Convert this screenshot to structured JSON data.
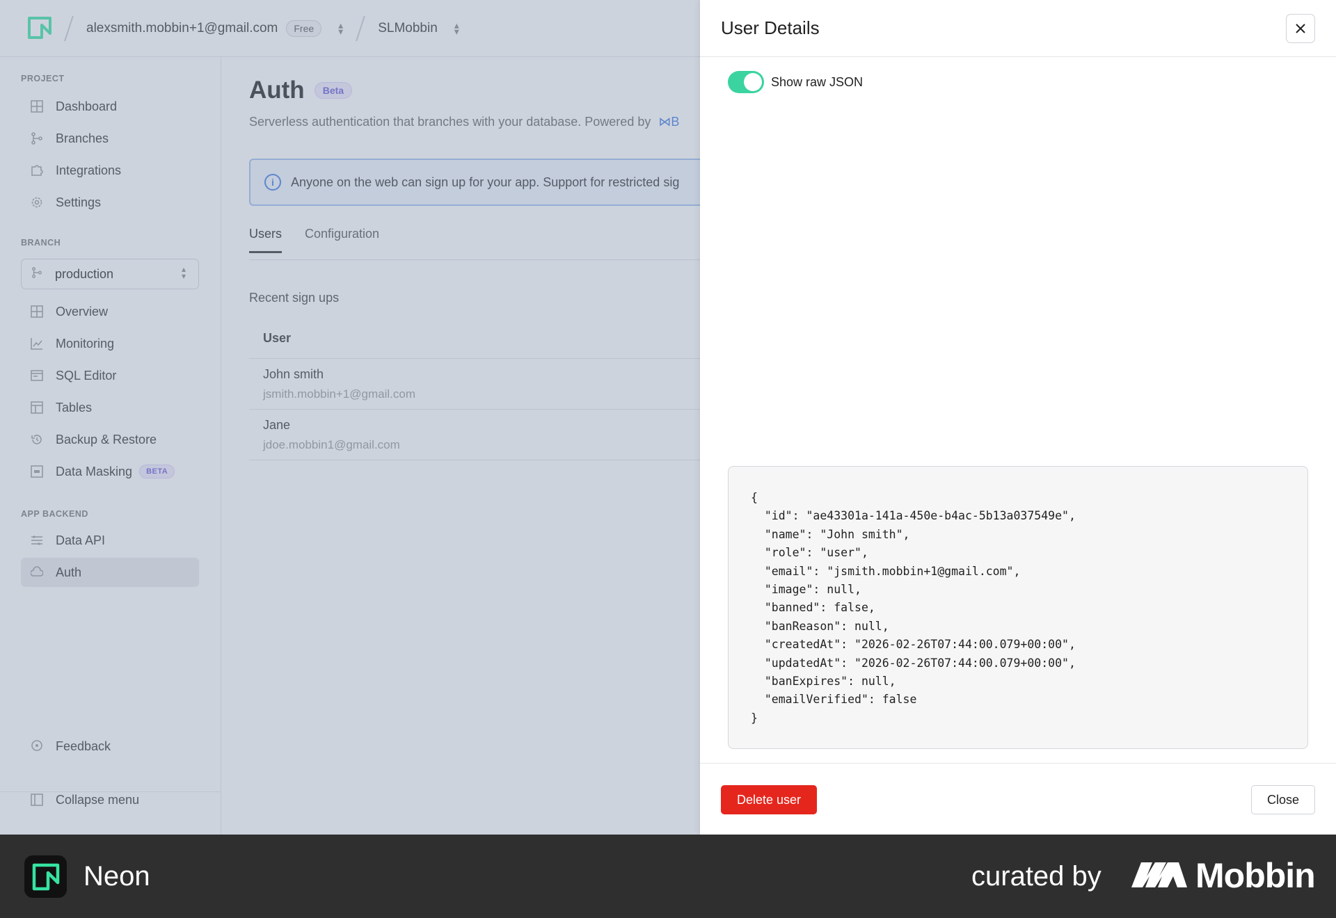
{
  "topbar": {
    "account_email": "alexsmith.mobbin+1@gmail.com",
    "plan_badge": "Free",
    "project_name": "SLMobbin"
  },
  "sidebar": {
    "project_label": "PROJECT",
    "project_items": [
      {
        "label": "Dashboard",
        "icon": "grid-icon"
      },
      {
        "label": "Branches",
        "icon": "branch-icon"
      },
      {
        "label": "Integrations",
        "icon": "puzzle-icon"
      },
      {
        "label": "Settings",
        "icon": "gear-icon"
      }
    ],
    "branch_label": "BRANCH",
    "branch_selected": "production",
    "branch_items": [
      {
        "label": "Overview",
        "icon": "grid-icon"
      },
      {
        "label": "Monitoring",
        "icon": "chart-icon"
      },
      {
        "label": "SQL Editor",
        "icon": "editor-icon"
      },
      {
        "label": "Tables",
        "icon": "table-icon"
      },
      {
        "label": "Backup & Restore",
        "icon": "history-icon"
      },
      {
        "label": "Data Masking",
        "icon": "mask-icon",
        "badge": "BETA"
      }
    ],
    "app_backend_label": "APP BACKEND",
    "app_backend_items": [
      {
        "label": "Data API",
        "icon": "api-icon"
      },
      {
        "label": "Auth",
        "icon": "cloud-lock-icon"
      }
    ],
    "feedback": "Feedback",
    "collapse": "Collapse menu"
  },
  "main": {
    "title": "Auth",
    "title_badge": "Beta",
    "subtitle": "Serverless authentication that branches with your database. Powered by",
    "subtitle_link": "B",
    "info_text": "Anyone on the web can sign up for your app. Support for restricted sig",
    "tabs": [
      "Users",
      "Configuration"
    ],
    "recent_label": "Recent sign ups",
    "table_header": "User",
    "rows": [
      {
        "name": "John smith",
        "email": "jsmith.mobbin+1@gmail.com"
      },
      {
        "name": "Jane",
        "email": "jdoe.mobbin1@gmail.com"
      }
    ]
  },
  "drawer": {
    "title": "User Details",
    "toggle_label": "Show raw JSON",
    "toggle_on": true,
    "json_text": "{\n  \"id\": \"ae43301a-141a-450e-b4ac-5b13a037549e\",\n  \"name\": \"John smith\",\n  \"role\": \"user\",\n  \"email\": \"jsmith.mobbin+1@gmail.com\",\n  \"image\": null,\n  \"banned\": false,\n  \"banReason\": null,\n  \"createdAt\": \"2026-02-26T07:44:00.079+00:00\",\n  \"updatedAt\": \"2026-02-26T07:44:00.079+00:00\",\n  \"banExpires\": null,\n  \"emailVerified\": false\n}",
    "delete_label": "Delete user",
    "close_label": "Close"
  },
  "branding": {
    "app_name": "Neon",
    "curated_by": "curated by",
    "mobbin": "Mobbin"
  },
  "colors": {
    "toggle_on": "#3bd39f",
    "delete": "#e5261d",
    "neon_green": "#37e3a2",
    "beta_purple": "#6a5bd8"
  }
}
